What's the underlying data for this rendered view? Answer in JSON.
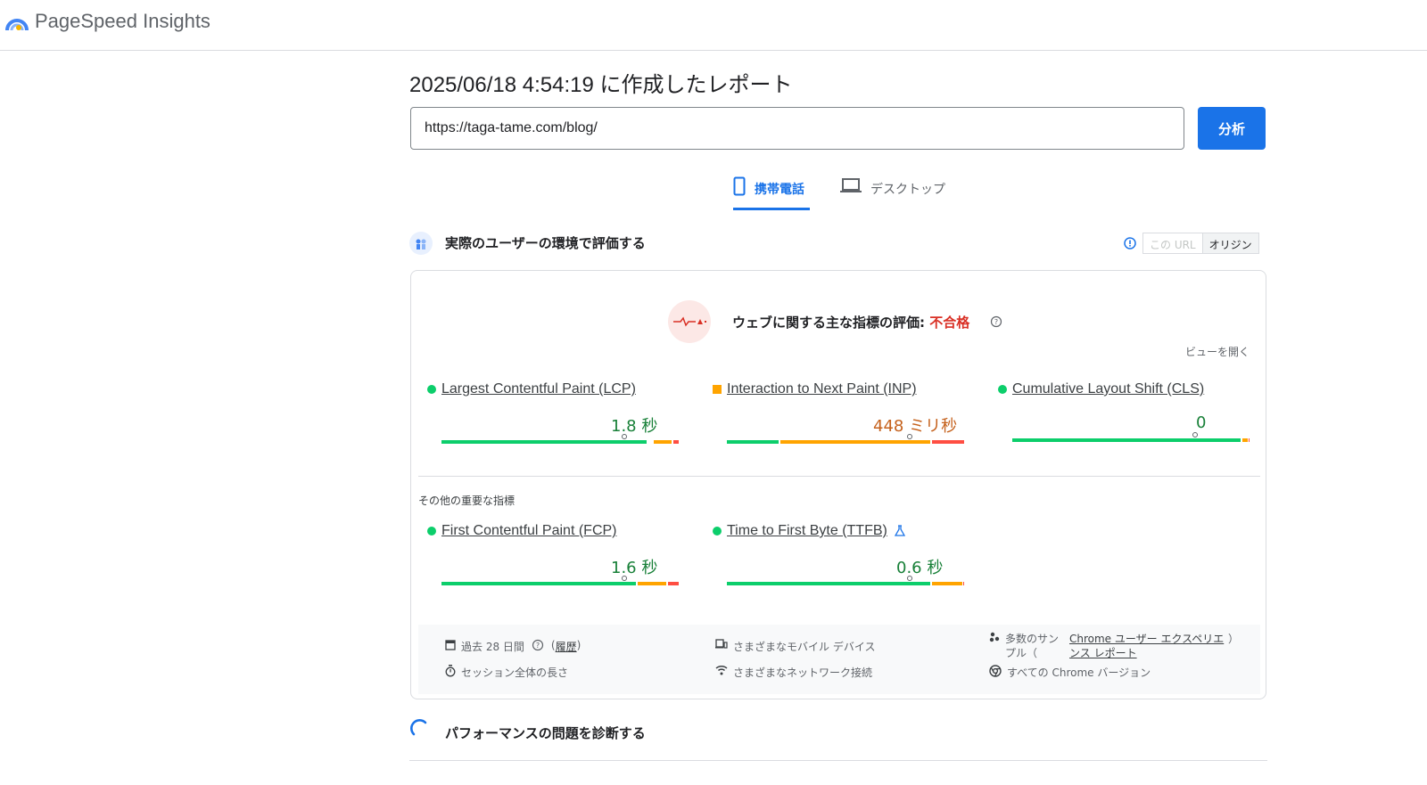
{
  "app": {
    "title": "PageSpeed Insights"
  },
  "report": {
    "title": "2025/06/18 4:54:19 に作成したレポート"
  },
  "search": {
    "value": "https://taga-tame.com/blog/",
    "button": "分析"
  },
  "tabs": [
    {
      "label": "携帯電話",
      "selected": true
    },
    {
      "label": "デスクトップ",
      "selected": false
    }
  ],
  "field": {
    "title": "実際のユーザーの環境で評価する",
    "toggle": {
      "this_url": "この URL",
      "origin": "オリジン"
    },
    "assessment": {
      "label": "ウェブに関する主な指標の評価: ",
      "result": "不合格"
    },
    "expand": "ビューを開く",
    "core_metrics": [
      {
        "name": "Largest Contentful Paint (LCP)",
        "value": "1.8 秒",
        "rating": "good"
      },
      {
        "name": "Interaction to Next Paint (INP)",
        "value": "448 ミリ秒",
        "rating": "needs-improvement"
      },
      {
        "name": "Cumulative Layout Shift (CLS)",
        "value": "0",
        "rating": "good"
      }
    ],
    "other_label": "その他の重要な指標",
    "other_metrics": [
      {
        "name": "First Contentful Paint (FCP)",
        "value": "1.6 秒",
        "rating": "good"
      },
      {
        "name": "Time to First Byte (TTFB)",
        "value": "0.6 秒",
        "rating": "good"
      }
    ],
    "footer": {
      "period": "過去 28 日間",
      "history": "履歴",
      "devices": "さまざまなモバイル デバイス",
      "samples_a": "多数のサン",
      "samples_b": "プル（",
      "samples_end": "）",
      "crux_a": "Chrome ユーザー エクスペリエ",
      "crux_b": "ンス レポート",
      "session": "セッション全体の長さ",
      "network": "さまざまなネットワーク接続",
      "chrome": "すべての Chrome バージョン"
    }
  },
  "diagnose": {
    "title": "パフォーマンスの問題を診断する"
  },
  "colors": {
    "good": "#0cce6b",
    "average": "#ffa400",
    "poor": "#ff4e42",
    "accent": "#1a73e8",
    "good_text": "#188038",
    "average_text": "#c5611c"
  }
}
